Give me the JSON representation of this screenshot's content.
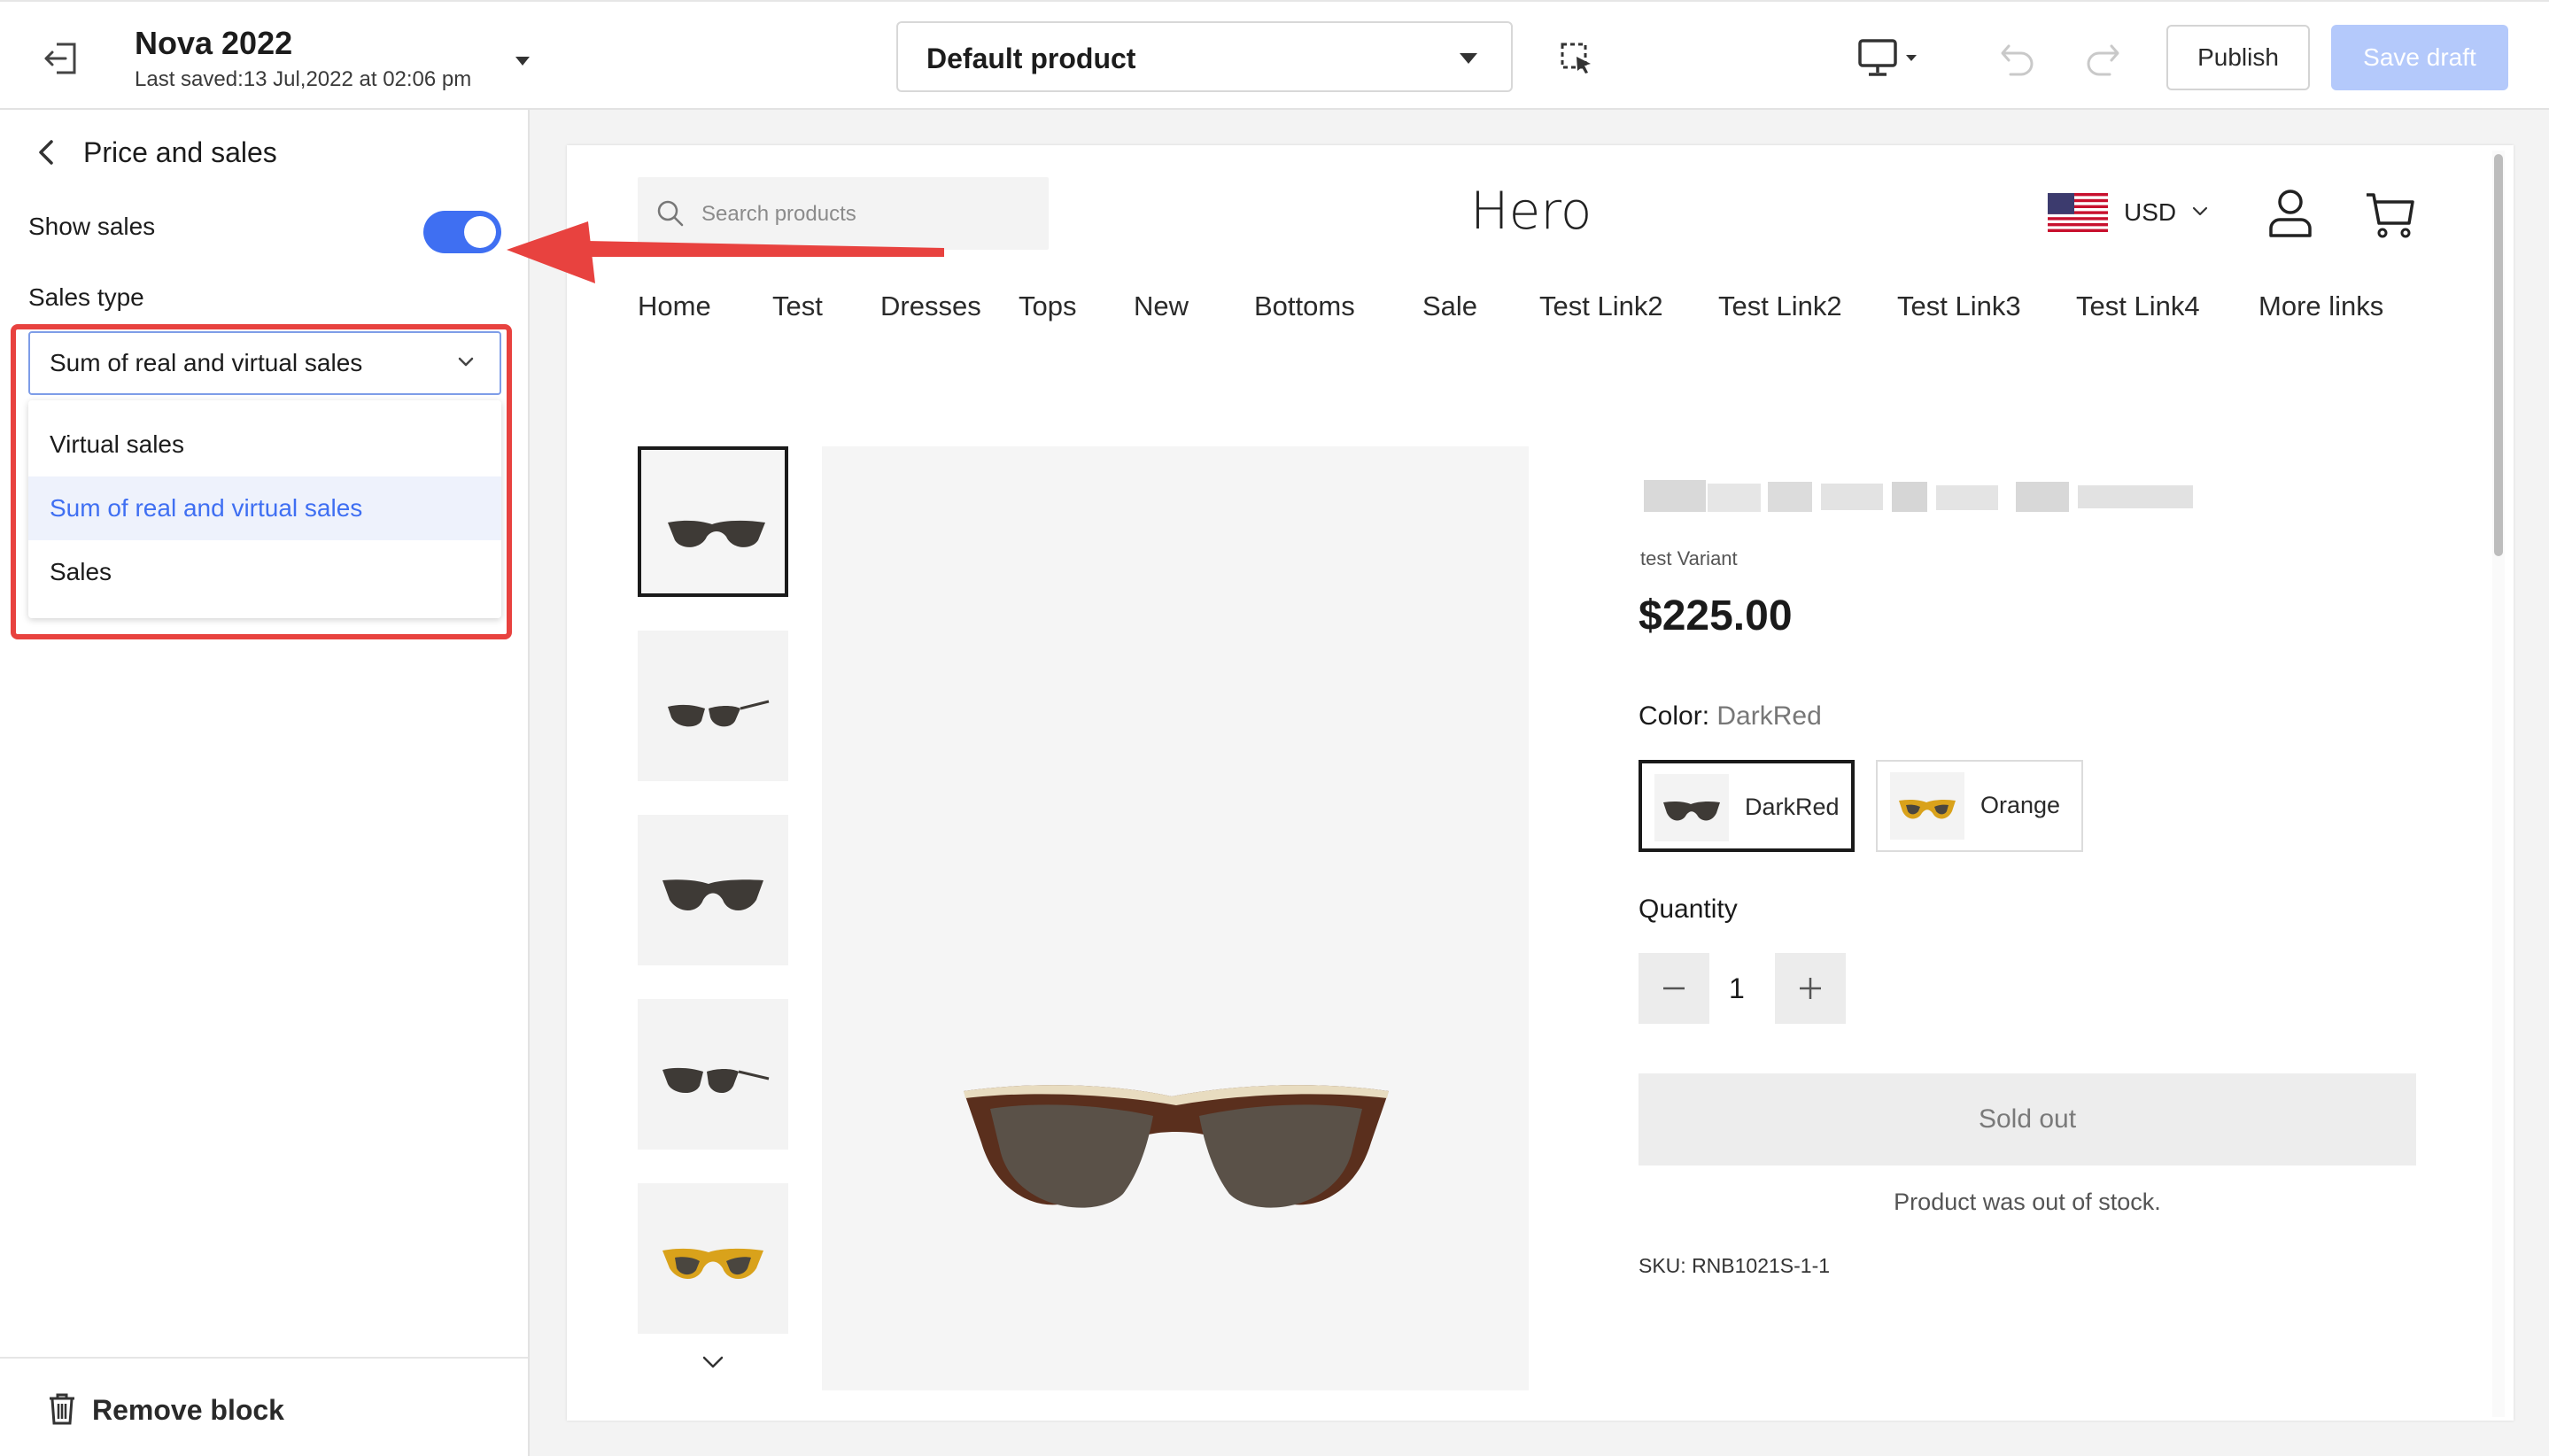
{
  "topbar": {
    "theme_name": "Nova 2022",
    "last_saved": "Last saved:13 Jul,2022 at 02:06 pm",
    "page_select_value": "Default product",
    "publish_label": "Publish",
    "save_draft_label": "Save draft"
  },
  "sidebar": {
    "panel_title": "Price and sales",
    "show_sales_label": "Show sales",
    "show_sales_enabled": true,
    "sales_type_label": "Sales type",
    "sales_type_value": "Sum of real and virtual sales",
    "sales_type_options": [
      "Virtual sales",
      "Sum of real and virtual sales",
      "Sales"
    ],
    "remove_block_label": "Remove block"
  },
  "preview": {
    "search_placeholder": "Search products",
    "store_title": "Hero",
    "currency": "USD",
    "nav": [
      "Home",
      "Test",
      "Dresses",
      "Tops",
      "New",
      "Bottoms",
      "Sale",
      "Test Link2",
      "Test Link2",
      "Test Link3",
      "Test Link4",
      "More links"
    ],
    "variant_label": "test Variant",
    "price": "$225.00",
    "color_label": "Color:",
    "color_value": "DarkRed",
    "swatches": [
      "DarkRed",
      "Orange"
    ],
    "quantity_label": "Quantity",
    "quantity_value": "1",
    "sold_out_label": "Sold out",
    "stock_message": "Product was out of stock.",
    "sku": "SKU: RNB1021S-1-1"
  },
  "colors": {
    "accent": "#3f6ff2",
    "annotation": "#e8423f",
    "save_draft_disabled": "#b4c9fb",
    "selected_option_bg": "#eef2fc"
  },
  "icons": [
    "exit-icon",
    "inspect-icon",
    "desktop-icon",
    "undo-icon",
    "redo-icon",
    "back-icon",
    "chevron-down-icon",
    "trash-icon",
    "search-icon",
    "us-flag-icon",
    "account-icon",
    "cart-icon",
    "minus-icon",
    "plus-icon"
  ]
}
